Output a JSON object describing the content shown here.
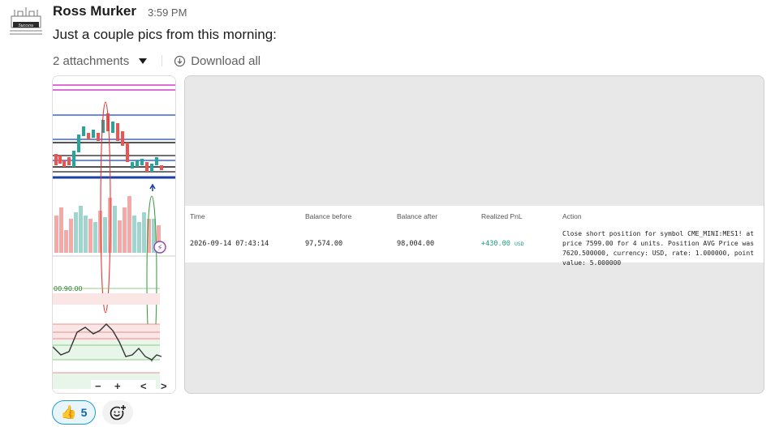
{
  "message": {
    "author": "Ross Murker",
    "time": "3:59 PM",
    "text": "Just a couple pics from this morning:",
    "avatar_text": "Success"
  },
  "attachments": {
    "count_label": "2 attachments",
    "download_label": "Download all"
  },
  "chart_image": {
    "level_label": "00.90.00",
    "controls": [
      "−",
      "+",
      "<",
      ">"
    ]
  },
  "trade_table": {
    "headers": [
      "Time",
      "Balance before",
      "Balance after",
      "Realized PnL",
      "Action"
    ],
    "row": {
      "time": "2026-09-14 07:43:14",
      "balance_before": "97,574.00",
      "balance_after": "98,004.00",
      "pnl": "+430.00",
      "pnl_currency": "USD",
      "action": "Close short position for symbol CME_MINI:MES1! at price 7599.00 for 4 units. Position AVG Price was 7620.500000, currency: USD, rate: 1.000000, point value: 5.000000"
    }
  },
  "reactions": {
    "thumbs_emoji": "👍",
    "thumbs_count": "5"
  },
  "colors": {
    "link_blue": "#1264a3",
    "pnl_green": "#1aa083",
    "reaction_border": "#1d9bd1"
  }
}
